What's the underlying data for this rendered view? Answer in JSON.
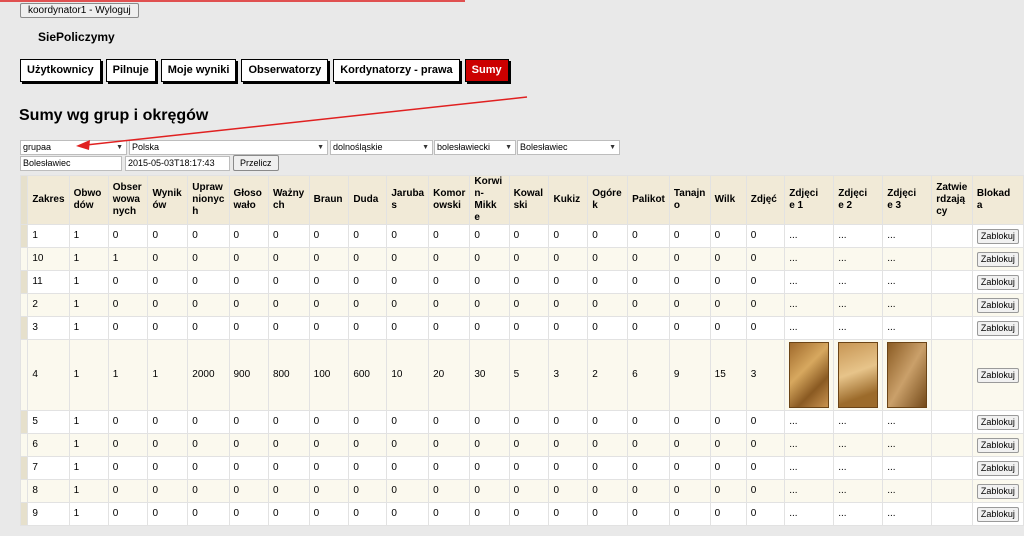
{
  "session": {
    "logout_label": "koordynator1 - Wyloguj"
  },
  "site": {
    "name": "SiePoliczymy"
  },
  "nav": [
    {
      "label": "Użytkownicy",
      "active": false
    },
    {
      "label": "Pilnuje",
      "active": false
    },
    {
      "label": "Moje wyniki",
      "active": false
    },
    {
      "label": "Obserwatorzy",
      "active": false
    },
    {
      "label": "Kordynatorzy - prawa",
      "active": false
    },
    {
      "label": "Sumy",
      "active": true
    }
  ],
  "page": {
    "title": "Sumy wg grup i okręgów"
  },
  "filters": {
    "group": "grupaa",
    "country": "Polska",
    "voivodeship": "dolnośląskie",
    "county": "bolesławiecki",
    "municipality": "Bolesławiec",
    "place": "Bolesławiec",
    "datetime": "2015-05-03T18:17:43",
    "recalc_label": "Przelicz"
  },
  "table": {
    "headers": [
      "Zakres",
      "Obwodów",
      "Obserwowanych",
      "Wyników",
      "Uprawnionych",
      "Głosowało",
      "Ważnych",
      "Braun",
      "Duda",
      "Jarubas",
      "Komorowski",
      "Korwin-Mikke",
      "Kowalski",
      "Kukiz",
      "Ogórek",
      "Palikot",
      "Tanajno",
      "Wilk",
      "Zdjęć",
      "Zdjęcie 1",
      "Zdjęcie 2",
      "Zdjęcie 3",
      "Zatwierdzający",
      "Blokada"
    ],
    "header_lines": [
      [
        "Zakres"
      ],
      [
        "Obwo",
        "dów"
      ],
      [
        "Obser",
        "wowa",
        "nych"
      ],
      [
        "Wynik",
        "ów"
      ],
      [
        "Upraw",
        "nionyc",
        "h"
      ],
      [
        "Głoso",
        "wało"
      ],
      [
        "Ważny",
        "ch"
      ],
      [
        "Braun"
      ],
      [
        "Duda"
      ],
      [
        "Jaruba",
        "s"
      ],
      [
        "Komor",
        "owski"
      ],
      [
        "Korwi",
        "n-Mikk",
        "e"
      ],
      [
        "Kowal",
        "ski"
      ],
      [
        "Kukiz"
      ],
      [
        "Ogóre",
        "k"
      ],
      [
        "Palikot"
      ],
      [
        "Tanajn",
        "o"
      ],
      [
        "Wilk"
      ],
      [
        "Zdjęć"
      ],
      [
        "Zdjęci",
        "e 1"
      ],
      [
        "Zdjęci",
        "e 2"
      ],
      [
        "Zdjęci",
        "e 3"
      ],
      [
        "Zatwie",
        "rdzają",
        "cy"
      ],
      [
        "Blokad",
        "a"
      ]
    ],
    "lock_label": "Zablokuj",
    "rows": [
      {
        "zakres": "1",
        "values": [
          "1",
          "0",
          "0",
          "0",
          "0",
          "0",
          "0",
          "0",
          "0",
          "0",
          "0",
          "0",
          "0",
          "0",
          "0",
          "0",
          "0",
          "0"
        ],
        "photos": [
          "...",
          "...",
          "..."
        ]
      },
      {
        "zakres": "10",
        "values": [
          "1",
          "1",
          "0",
          "0",
          "0",
          "0",
          "0",
          "0",
          "0",
          "0",
          "0",
          "0",
          "0",
          "0",
          "0",
          "0",
          "0",
          "0"
        ],
        "photos": [
          "...",
          "...",
          "..."
        ]
      },
      {
        "zakres": "11",
        "values": [
          "1",
          "0",
          "0",
          "0",
          "0",
          "0",
          "0",
          "0",
          "0",
          "0",
          "0",
          "0",
          "0",
          "0",
          "0",
          "0",
          "0",
          "0"
        ],
        "photos": [
          "...",
          "...",
          "..."
        ]
      },
      {
        "zakres": "2",
        "values": [
          "1",
          "0",
          "0",
          "0",
          "0",
          "0",
          "0",
          "0",
          "0",
          "0",
          "0",
          "0",
          "0",
          "0",
          "0",
          "0",
          "0",
          "0"
        ],
        "photos": [
          "...",
          "...",
          "..."
        ]
      },
      {
        "zakres": "3",
        "values": [
          "1",
          "0",
          "0",
          "0",
          "0",
          "0",
          "0",
          "0",
          "0",
          "0",
          "0",
          "0",
          "0",
          "0",
          "0",
          "0",
          "0",
          "0"
        ],
        "photos": [
          "...",
          "...",
          "..."
        ]
      },
      {
        "zakres": "4",
        "values": [
          "1",
          "1",
          "1",
          "2000",
          "900",
          "800",
          "100",
          "600",
          "10",
          "20",
          "30",
          "5",
          "3",
          "2",
          "6",
          "9",
          "15",
          "3"
        ],
        "photos": [
          "img",
          "img",
          "img"
        ]
      },
      {
        "zakres": "5",
        "values": [
          "1",
          "0",
          "0",
          "0",
          "0",
          "0",
          "0",
          "0",
          "0",
          "0",
          "0",
          "0",
          "0",
          "0",
          "0",
          "0",
          "0",
          "0"
        ],
        "photos": [
          "...",
          "...",
          "..."
        ]
      },
      {
        "zakres": "6",
        "values": [
          "1",
          "0",
          "0",
          "0",
          "0",
          "0",
          "0",
          "0",
          "0",
          "0",
          "0",
          "0",
          "0",
          "0",
          "0",
          "0",
          "0",
          "0"
        ],
        "photos": [
          "...",
          "...",
          "..."
        ]
      },
      {
        "zakres": "7",
        "values": [
          "1",
          "0",
          "0",
          "0",
          "0",
          "0",
          "0",
          "0",
          "0",
          "0",
          "0",
          "0",
          "0",
          "0",
          "0",
          "0",
          "0",
          "0"
        ],
        "photos": [
          "...",
          "...",
          "..."
        ]
      },
      {
        "zakres": "8",
        "values": [
          "1",
          "0",
          "0",
          "0",
          "0",
          "0",
          "0",
          "0",
          "0",
          "0",
          "0",
          "0",
          "0",
          "0",
          "0",
          "0",
          "0",
          "0"
        ],
        "photos": [
          "...",
          "...",
          "..."
        ]
      },
      {
        "zakres": "9",
        "values": [
          "1",
          "0",
          "0",
          "0",
          "0",
          "0",
          "0",
          "0",
          "0",
          "0",
          "0",
          "0",
          "0",
          "0",
          "0",
          "0",
          "0",
          "0"
        ],
        "photos": [
          "...",
          "...",
          "..."
        ]
      }
    ]
  },
  "colors": {
    "accent_red": "#cc0000",
    "header_bg": "#f1ead7",
    "page_bg": "#e9e9e9"
  }
}
